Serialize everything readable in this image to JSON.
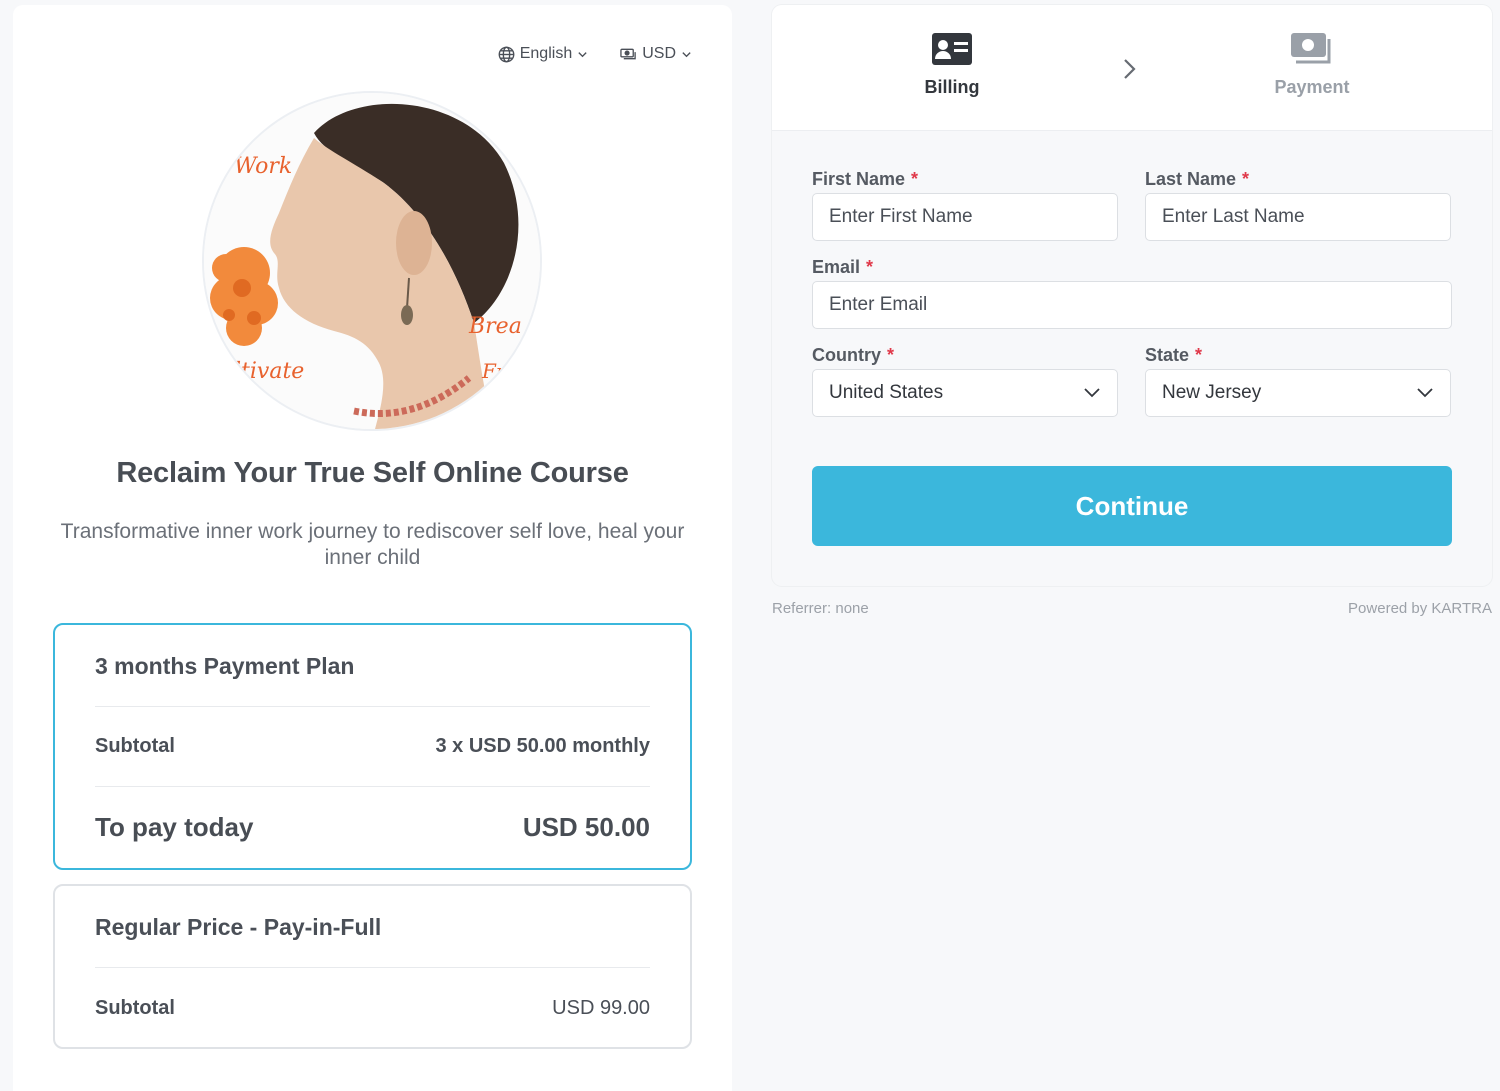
{
  "header": {
    "language": "English",
    "currency": "USD"
  },
  "product": {
    "title": "Reclaim Your True Self Online Course",
    "description": "Transformative inner work journey to rediscover self love, heal your inner child",
    "image_words": [
      "Work",
      "Brea",
      "ltivate",
      "Fr"
    ]
  },
  "plans": [
    {
      "name": "3 months Payment Plan",
      "subtotal_label": "Subtotal",
      "subtotal_value": "3 x USD 50.00 monthly",
      "today_label": "To pay today",
      "today_value": "USD 50.00",
      "selected": true
    },
    {
      "name": "Regular Price - Pay-in-Full",
      "subtotal_label": "Subtotal",
      "subtotal_value": "USD 99.00",
      "selected": false
    }
  ],
  "steps": {
    "billing": "Billing",
    "payment": "Payment"
  },
  "form": {
    "first_name": {
      "label": "First Name",
      "placeholder": "Enter First Name"
    },
    "last_name": {
      "label": "Last Name",
      "placeholder": "Enter Last Name"
    },
    "email": {
      "label": "Email",
      "placeholder": "Enter Email"
    },
    "country": {
      "label": "Country",
      "value": "United States"
    },
    "state": {
      "label": "State",
      "value": "New Jersey"
    },
    "required_mark": "*",
    "continue_label": "Continue"
  },
  "footer": {
    "referrer": "Referrer: none",
    "powered": "Powered by KARTRA"
  },
  "colors": {
    "accent": "#3bb7dc",
    "required": "#e0394a"
  }
}
